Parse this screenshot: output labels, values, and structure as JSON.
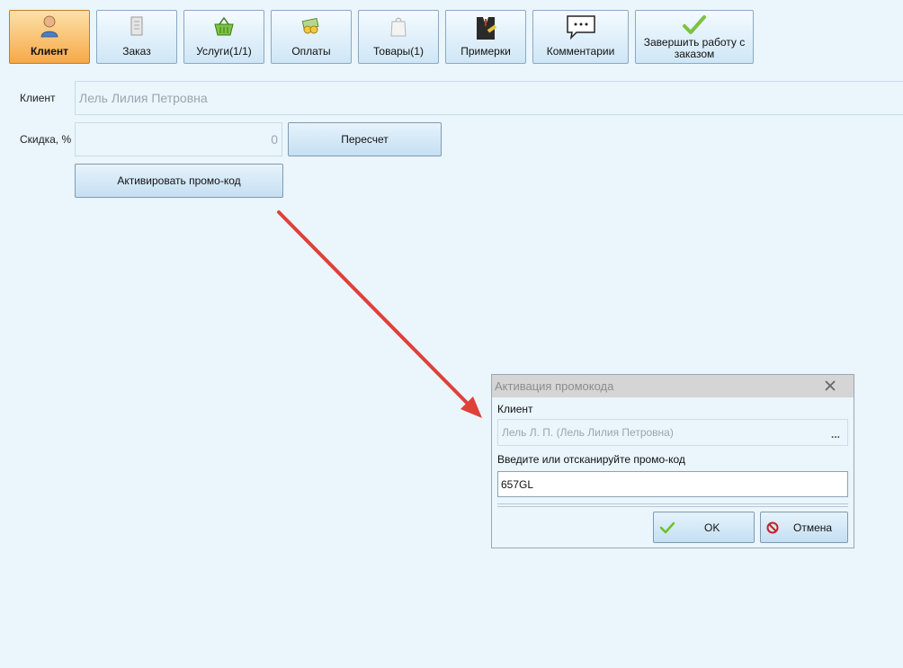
{
  "toolbar": {
    "client": "Клиент",
    "order": "Заказ",
    "services": "Услуги(1/1)",
    "payments": "Оплаты",
    "goods": "Товары(1)",
    "fittings": "Примерки",
    "comments": "Комментарии",
    "finish": "Завершить работу с заказом"
  },
  "form": {
    "client_label": "Клиент",
    "client_value": "Лель Лилия Петровна",
    "discount_label": "Скидка, %",
    "discount_value": "0",
    "recalc_button": "Пересчет",
    "promo_button": "Активировать промо-код"
  },
  "dialog": {
    "title": "Активация промокода",
    "client_label": "Клиент",
    "client_value": "Лель Л. П. (Лель Лилия Петровна)",
    "browse_dots": "...",
    "code_label": "Введите или отсканируйте промо-код",
    "code_value": "657GL",
    "ok_button": "OK",
    "cancel_button": "Отмена"
  },
  "colors": {
    "active_tab": "#f6a948",
    "background": "#eaf5fc",
    "arrow": "#e0403a",
    "ok_check": "#6fbf2a",
    "cancel_icon": "#c8202a"
  },
  "icons": {
    "client": "person-icon",
    "order": "document-icon",
    "services": "basket-icon",
    "payments": "money-icon",
    "goods": "shopping-bag-icon",
    "fittings": "suit-icon",
    "comments": "speech-bubble-icon",
    "finish": "checkmark-icon"
  }
}
